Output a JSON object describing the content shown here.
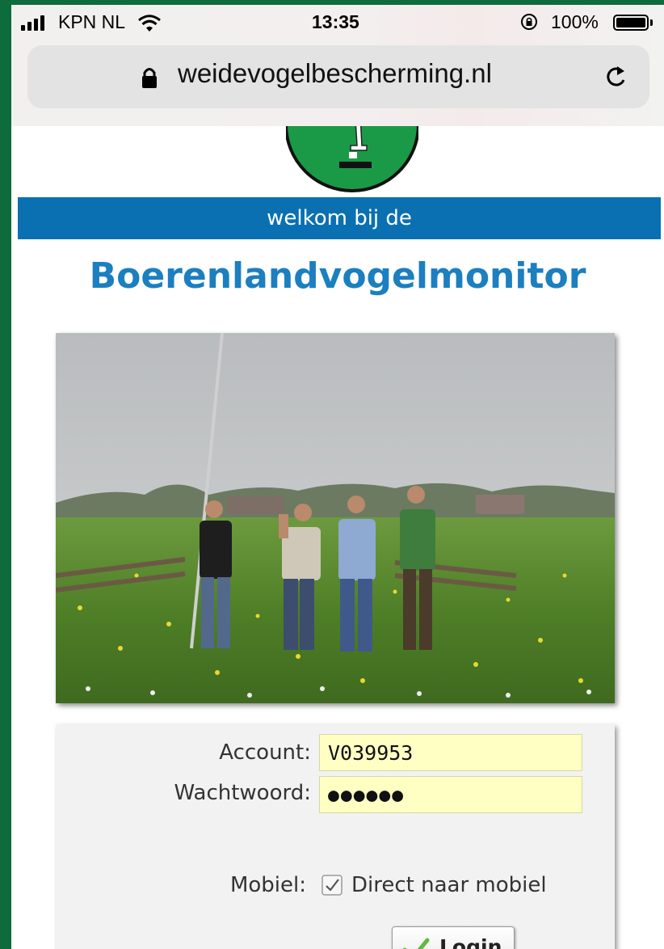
{
  "status_bar": {
    "carrier": "KPN NL",
    "time": "13:35",
    "battery": "100%"
  },
  "browser": {
    "url": "weidevogelbescherming.nl"
  },
  "banner": {
    "welcome": "welkom bij de",
    "title": "Boerenlandvogelmonitor"
  },
  "login_form": {
    "account_label": "Account:",
    "account_value": "V039953",
    "password_label": "Wachtwoord:",
    "password_value": "●●●●●●",
    "mobile_label": "Mobiel:",
    "mobile_checkbox_label": "Direct naar mobiel",
    "mobile_checked": true,
    "login_button": "Login"
  },
  "colors": {
    "brand_green": "#0d6b3c",
    "banner_blue": "#0a70b2",
    "title_blue": "#1b7fc0",
    "input_yellow": "#ffffc4"
  }
}
